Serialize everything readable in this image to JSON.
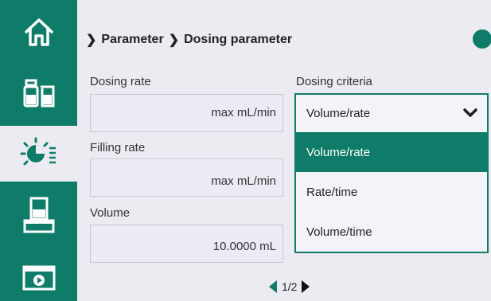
{
  "sidebar": {
    "items": [
      {
        "icon": "home-icon"
      },
      {
        "icon": "bottle-beaker-icon"
      },
      {
        "icon": "dosing-pump-icon"
      },
      {
        "icon": "beaker-scale-icon"
      },
      {
        "icon": "video-icon"
      }
    ]
  },
  "breadcrumb": {
    "level1": "Parameter",
    "level2": "Dosing parameter"
  },
  "fields": {
    "dosing_rate": {
      "label": "Dosing rate",
      "value": "max mL/min"
    },
    "filling_rate": {
      "label": "Filling rate",
      "value": "max mL/min"
    },
    "volume": {
      "label": "Volume",
      "value": "10.0000 mL"
    }
  },
  "dosing_criteria": {
    "label": "Dosing criteria",
    "selected": "Volume/rate",
    "options": [
      "Volume/rate",
      "Rate/time",
      "Volume/time"
    ]
  },
  "pager": {
    "text": "1/2"
  },
  "colors": {
    "accent": "#0e7c68",
    "background": "#ecebf1"
  }
}
